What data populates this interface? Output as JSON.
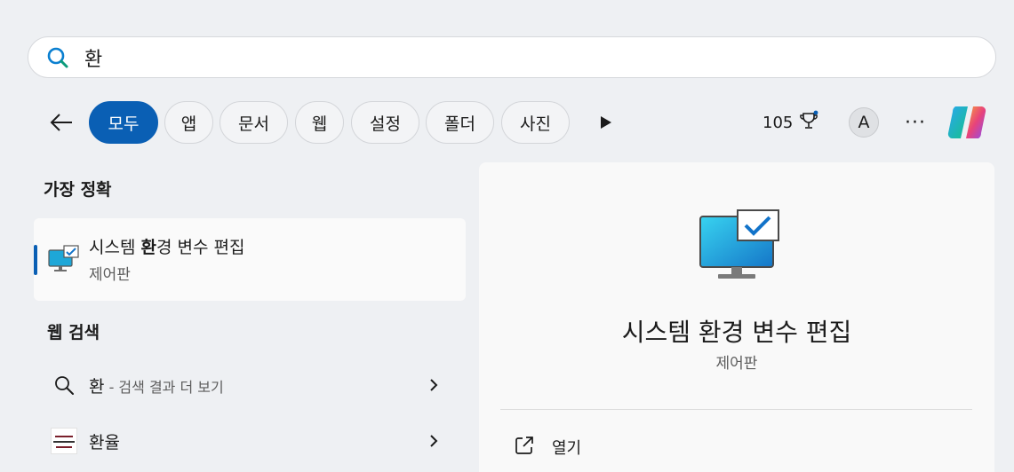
{
  "search": {
    "query": "환",
    "icon": "search-icon"
  },
  "filters": {
    "back_icon": "back-arrow-icon",
    "chips": [
      "모두",
      "앱",
      "문서",
      "웹",
      "설정",
      "폴더",
      "사진"
    ],
    "active_index": 0,
    "more_icon": "play-triangle-icon",
    "points": "105",
    "avatar_initial": "A",
    "ellipsis": "···",
    "copilot_icon": "copilot-icon"
  },
  "best_match": {
    "heading": "가장 정확",
    "title_before": "시스템 ",
    "title_bold": "환",
    "title_after": "경 변수 편집",
    "subtitle": "제어판"
  },
  "web_search": {
    "heading": "웹 검색",
    "items": [
      {
        "label": "환",
        "hint": " - 검색 결과 더 보기"
      },
      {
        "label": "환율",
        "hint": ""
      }
    ]
  },
  "detail": {
    "name": "시스템 환경 변수 편집",
    "type": "제어판",
    "actions": [
      {
        "label": "열기",
        "icon": "open-external-icon"
      }
    ]
  },
  "colors": {
    "accent": "#0a5fb4",
    "background": "#eef0f3",
    "panel": "#f9f9f9"
  }
}
